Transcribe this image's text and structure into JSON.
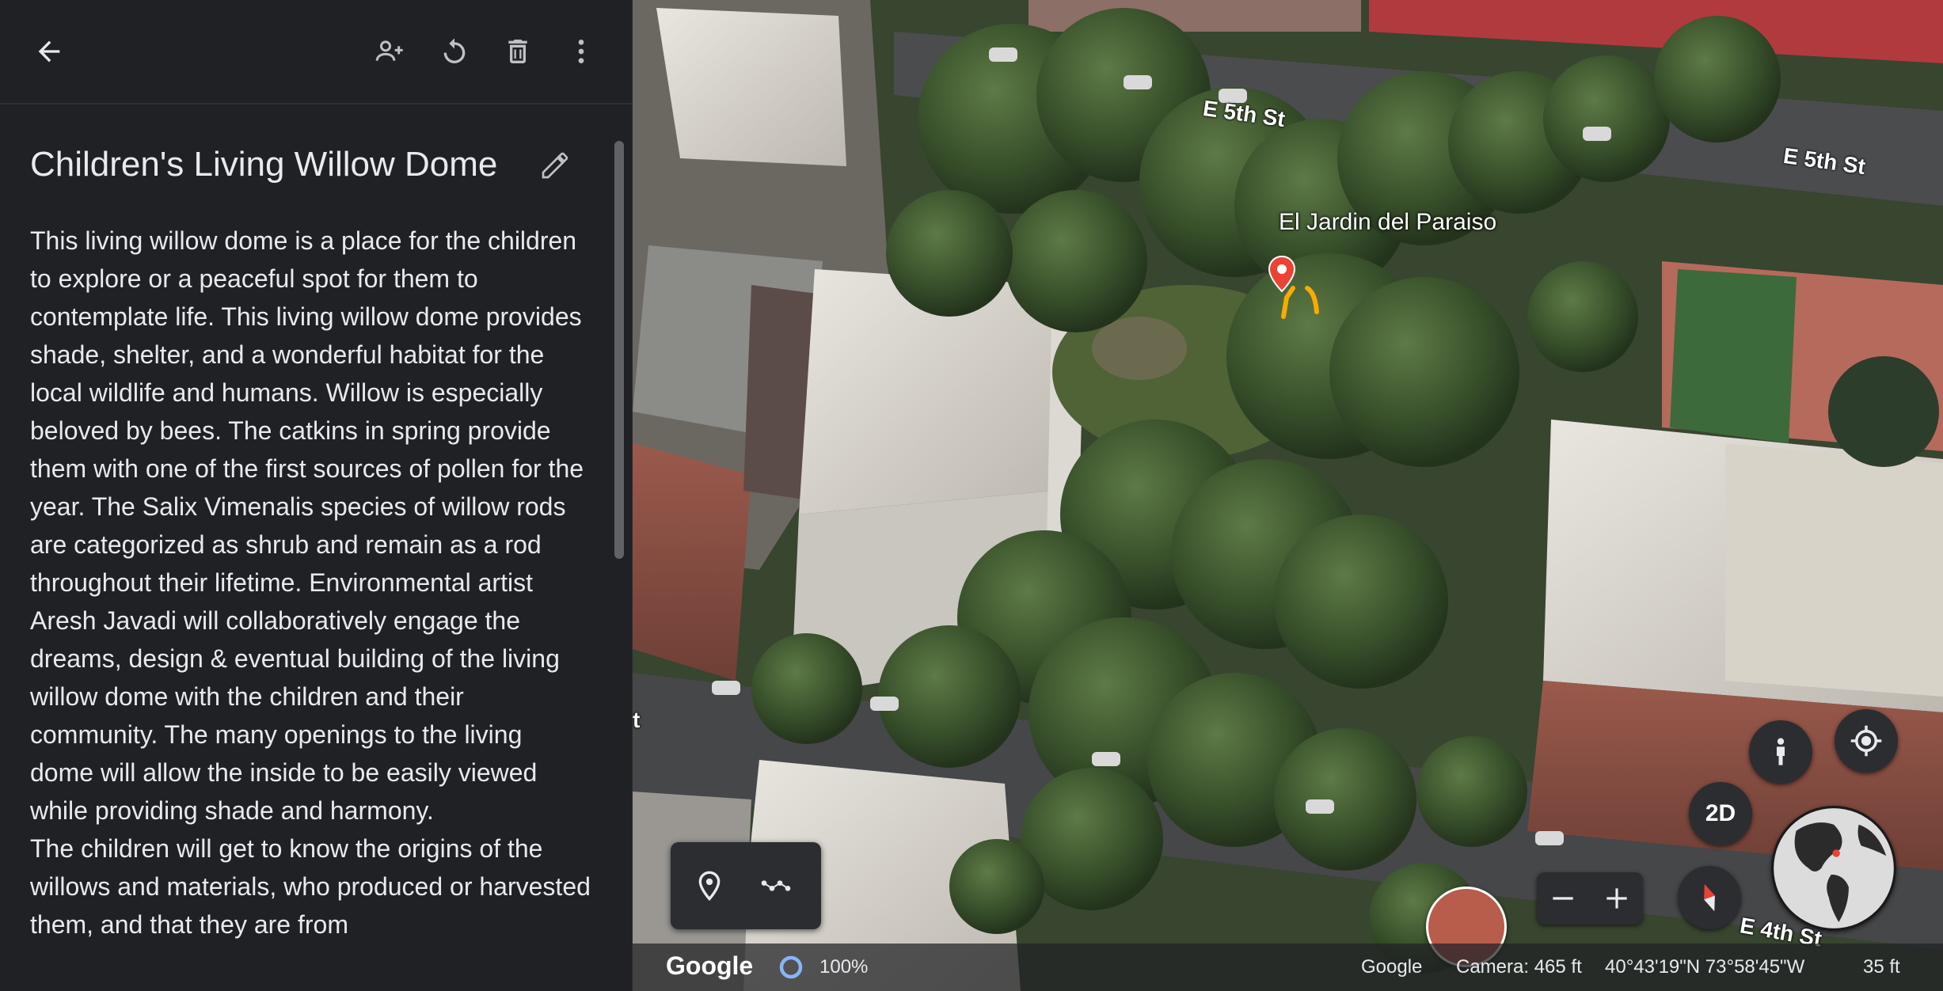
{
  "toolbar": {
    "back": "arrow-back-icon",
    "share": "person-add-icon",
    "reset": "refresh-icon",
    "delete": "trash-icon",
    "more": "more-vert-icon"
  },
  "feature": {
    "title": "Children's Living Willow Dome",
    "paragraph1": "This living willow dome is a place for the children to explore or a peaceful spot for them to contemplate life. This living willow dome provides shade, shelter, and a wonderful habitat for the local wildlife and humans. Willow is especially beloved by bees. The catkins in spring provide them with one of the first sources of pollen for the year. The Salix Vimenalis species of willow rods are categorized as shrub and remain as a rod throughout their lifetime. Environmental artist Aresh Javadi will collaboratively engage the dreams, design & eventual building of the living willow dome with the children and their community. The many openings to the living dome will allow the inside to be easily viewed while providing shade and harmony.",
    "paragraph2": "The children will get to know the origins of the willows and materials, who produced or harvested them, and that they are from"
  },
  "map": {
    "street_1": "E 5th St",
    "street_2": "E 5th St",
    "street_3": "E 4th St",
    "street_4": "t",
    "place": "El Jardin del Paraiso",
    "btn_2d": "2D",
    "marker_color": "#ea4335",
    "accent_color": "#f9ab00"
  },
  "status": {
    "logo": "Google",
    "percent": "100%",
    "attribution": "Google",
    "camera": "Camera: 465 ft",
    "coords": "40°43'19\"N 73°58'45\"W",
    "scale": "35 ft"
  }
}
